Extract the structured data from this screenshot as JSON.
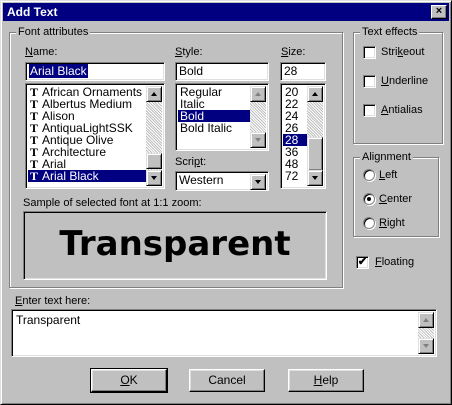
{
  "dialog": {
    "title": "Add Text",
    "close_glyph": "×"
  },
  "font_attributes": {
    "group_label": "Font attributes",
    "name": {
      "label_ul": "N",
      "label_rest": "ame:",
      "value": "Arial Black",
      "items": [
        {
          "icon": "T",
          "label": "African Ornaments One"
        },
        {
          "icon": "T",
          "label": "Albertus Medium"
        },
        {
          "icon": "T",
          "label": "Alison"
        },
        {
          "icon": "T",
          "label": "AntiquaLightSSK"
        },
        {
          "icon": "T",
          "label": "Antique Olive"
        },
        {
          "icon": "T",
          "label": "Architecture"
        },
        {
          "icon": "T",
          "label": "Arial"
        },
        {
          "icon": "T",
          "label": "Arial Black",
          "selected": true
        }
      ]
    },
    "style": {
      "label_ul": "S",
      "label_rest": "tyle:",
      "value": "Bold",
      "items": [
        {
          "label": "Regular"
        },
        {
          "label": "Italic"
        },
        {
          "label": "Bold",
          "selected": true
        },
        {
          "label": "Bold Italic"
        }
      ]
    },
    "size": {
      "label_ul": "S",
      "label_rest": "ize:",
      "value": "28",
      "items": [
        {
          "label": "20"
        },
        {
          "label": "22"
        },
        {
          "label": "24"
        },
        {
          "label": "26"
        },
        {
          "label": "28",
          "selected": true
        },
        {
          "label": "36"
        },
        {
          "label": "48"
        },
        {
          "label": "72"
        }
      ]
    },
    "script": {
      "label_pre": "Scri",
      "label_ul": "p",
      "label_rest": "t:",
      "value": "Western"
    },
    "sample": {
      "label": "Sample of selected font at 1:1 zoom:",
      "text": "Transparent"
    }
  },
  "text_effects": {
    "group_label": "Text effects",
    "items": [
      {
        "label_pre": "Stri",
        "label_ul": "k",
        "label_rest": "eout",
        "checked": ""
      },
      {
        "label_pre": "",
        "label_ul": "U",
        "label_rest": "nderline",
        "checked": ""
      },
      {
        "label_pre": "",
        "label_ul": "A",
        "label_rest": "ntialias",
        "checked": ""
      }
    ]
  },
  "alignment": {
    "group_label": "Alignment",
    "items": [
      {
        "label_ul": "L",
        "label_rest": "eft",
        "selected": false
      },
      {
        "label_ul": "C",
        "label_rest": "enter",
        "selected": true
      },
      {
        "label_ul": "R",
        "label_rest": "ight",
        "selected": false
      }
    ]
  },
  "floating": {
    "label_ul": "F",
    "label_rest": "loating",
    "checked": "✔"
  },
  "enter_text": {
    "label_ul": "E",
    "label_rest": "nter text here:",
    "value": "Transparent"
  },
  "buttons": {
    "ok": {
      "label_ul": "O",
      "label_rest": "K"
    },
    "cancel": {
      "label_ul": "",
      "label_rest": "Cancel"
    },
    "help": {
      "label_ul": "H",
      "label_rest": "elp"
    }
  }
}
